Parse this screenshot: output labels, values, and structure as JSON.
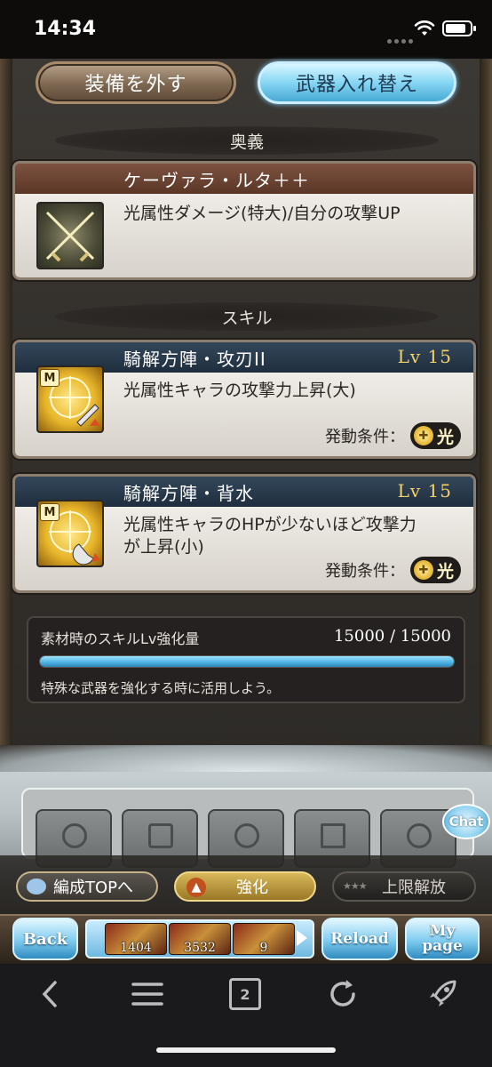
{
  "status": {
    "time": "14:34"
  },
  "top_buttons": {
    "unequip": "装備を外す",
    "swap": "武器入れ替え"
  },
  "ougi": {
    "section": "奥義",
    "name": "ケーヴァラ・ルタ＋＋",
    "desc": "光属性ダメージ(特大)/自分の攻撃UP"
  },
  "skills": {
    "section": "スキル",
    "condition_label": "発動条件：",
    "element": "光",
    "badge": "M",
    "items": [
      {
        "name": "騎解方陣・攻刃II",
        "level": "Lv 15",
        "desc_line1": "光属性キャラの攻撃力上昇(大)",
        "desc_line2": ""
      },
      {
        "name": "騎解方陣・背水",
        "level": "Lv 15",
        "desc_line1": "光属性キャラのHPが少ないほど攻撃力",
        "desc_line2": "が上昇(小)"
      }
    ]
  },
  "material": {
    "label": "素材時のスキルLv強化量",
    "value": "15000 / 15000",
    "progress": 1.0,
    "note": "特殊な武器を強化する時に活用しよう。"
  },
  "chat": "Chat",
  "actions": {
    "formation": "編成TOPへ",
    "upgrade": "強化",
    "uncap": "上限解放"
  },
  "nav": {
    "back": "Back",
    "reload": "Reload",
    "mypage_line1": "My",
    "mypage_line2": "page",
    "items": [
      {
        "count": "1404"
      },
      {
        "count": "3532"
      },
      {
        "count": "9"
      }
    ]
  },
  "browser": {
    "tab_count": "2"
  },
  "colors": {
    "accent_blue": "#4bb0e0",
    "skill_header": "#1f2e3e",
    "ougi_header": "#5a3626",
    "level_gold": "#f5d26a"
  }
}
